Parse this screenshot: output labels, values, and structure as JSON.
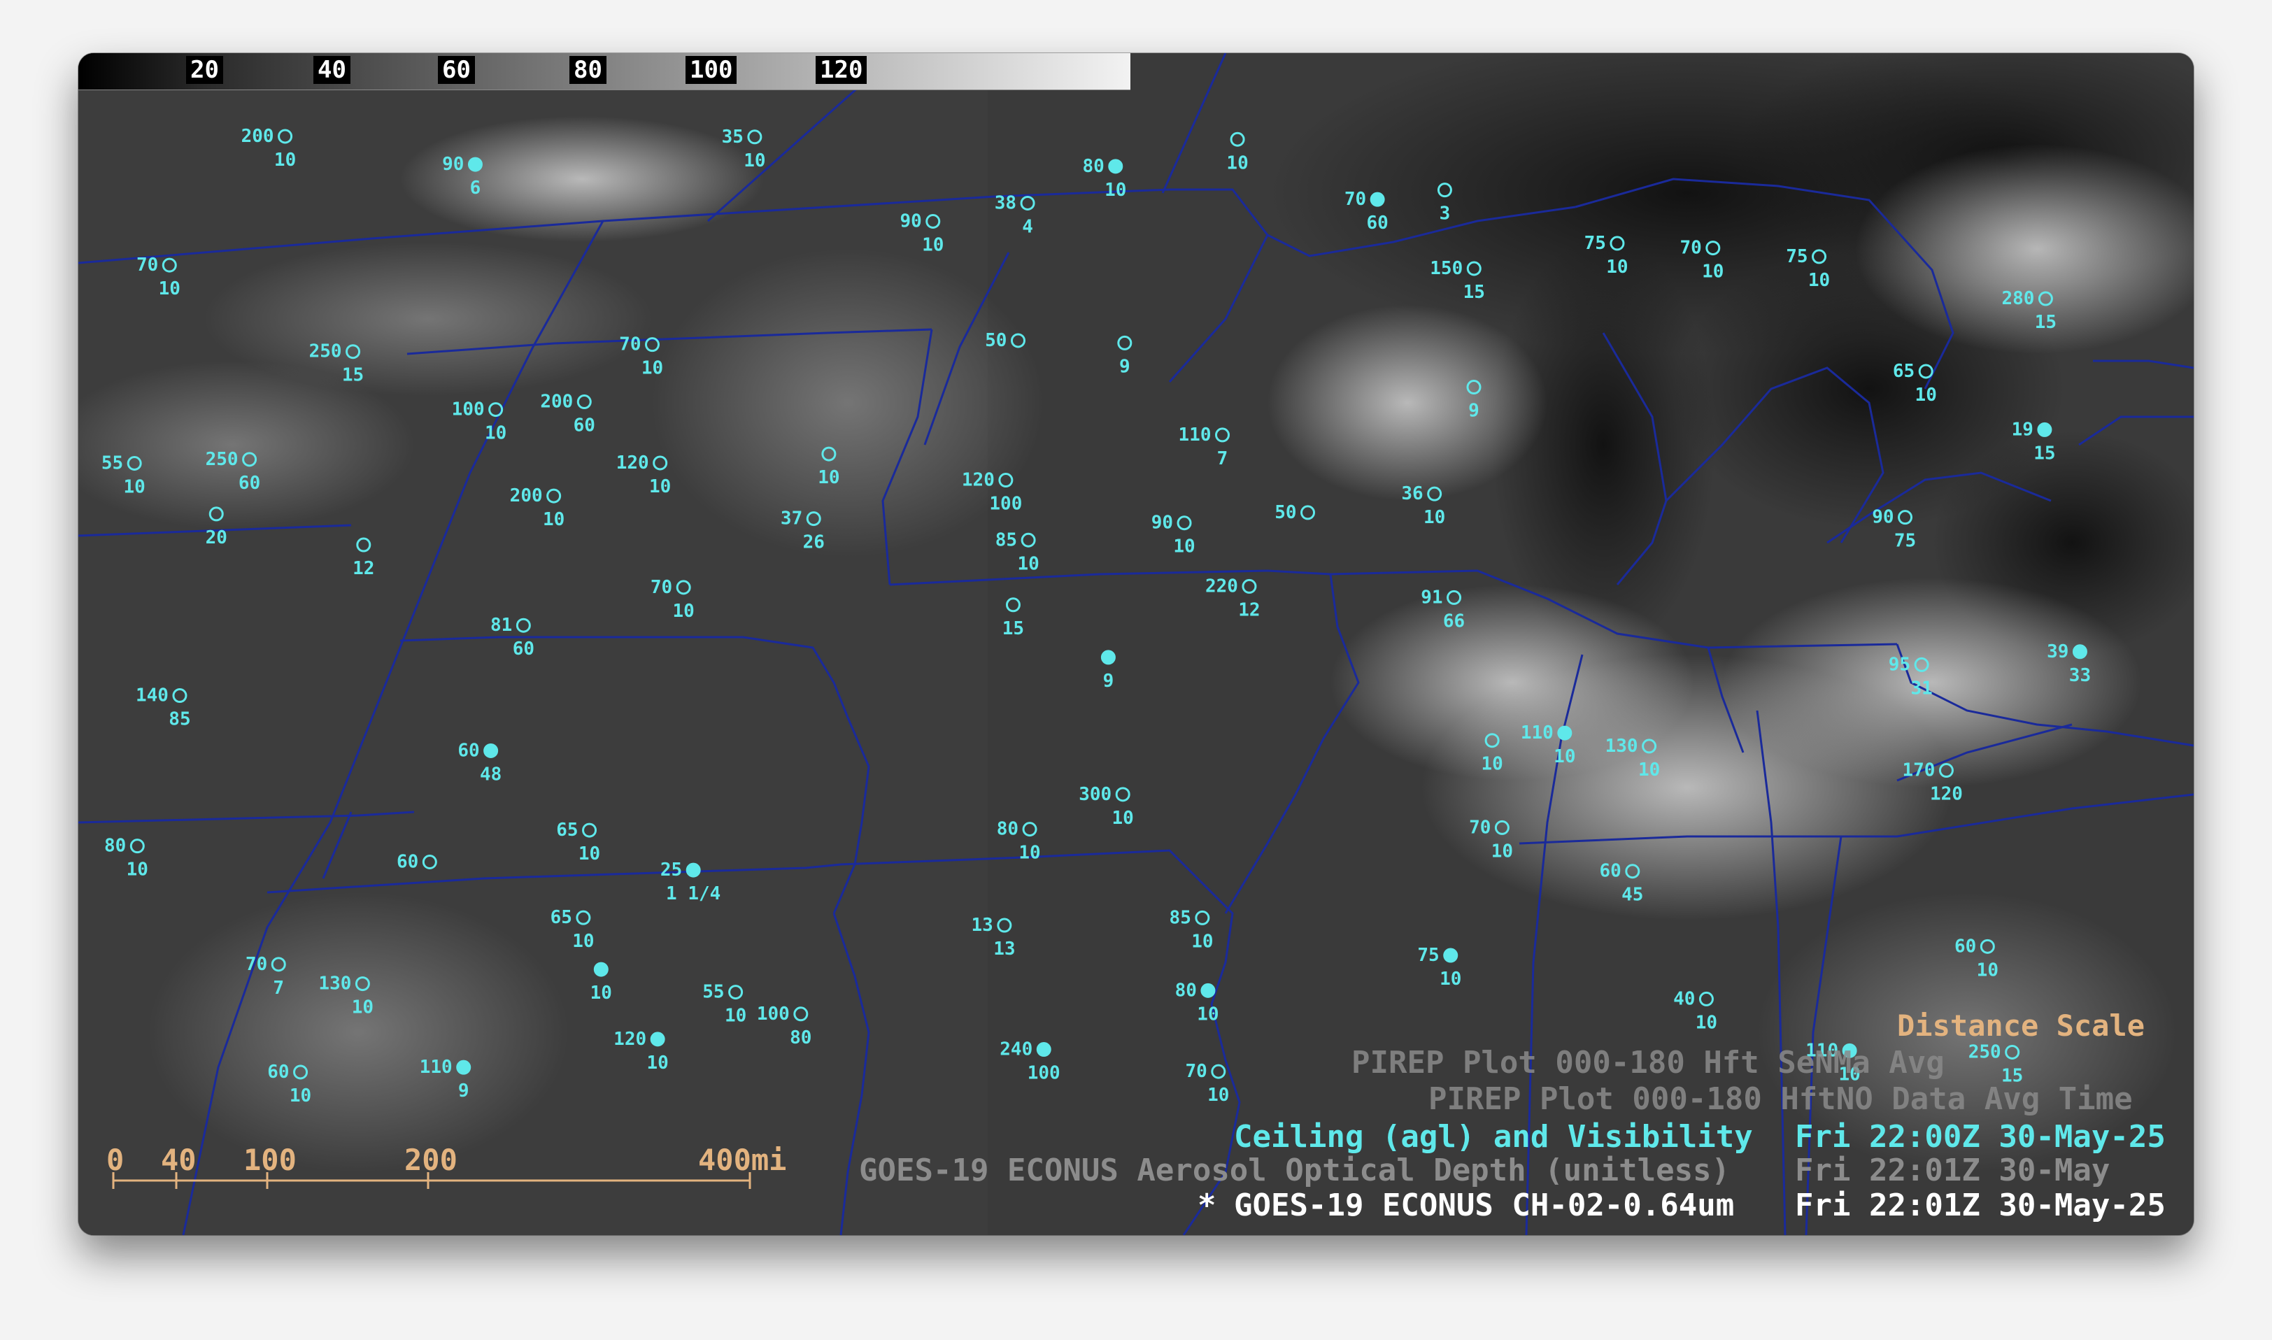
{
  "colorbar": {
    "ticks": [
      "20",
      "40",
      "60",
      "80",
      "100",
      "120"
    ]
  },
  "legend": {
    "pirep_1": "PIREP Plot 000-180 Hft SeNMa Avg",
    "pirep_2": "PIREP Plot 000-180 HftNO Data Avg Time",
    "ceiling_title": "Ceiling (agl) and Visibility",
    "ceiling_time": "Fri 22:00Z 30-May-25",
    "aerosol_title": "GOES-19 ECONUS Aerosol Optical Depth (unitless)",
    "aerosol_time": "Fri 22:01Z 30-May",
    "main_marker": "*",
    "main_title": "GOES-19 ECONUS CH-02-0.64um",
    "main_time": "Fri 22:01Z 30-May-25",
    "distance_scale": "Distance Scale"
  },
  "scale": {
    "ticks": [
      "0",
      "40",
      "100",
      "200",
      "400mi"
    ]
  },
  "colors": {
    "obs": "#5fe8ea",
    "borders": "#1a2a9a",
    "scale": "#e3b37f",
    "legend_text": "#5fe8ea",
    "legend_faded": "#8c8c8c"
  },
  "observations": [
    {
      "ceil": "",
      "vis": "9"
    },
    {
      "ceil": "250",
      "vis": "15"
    },
    {
      "ceil": "",
      "vis": "15"
    },
    {
      "ceil": "70",
      "vis": "7"
    },
    {
      "ceil": "50",
      "vis": ""
    },
    {
      "ceil": "25",
      "vis": "1 1/4"
    },
    {
      "ceil": "",
      "vis": "3"
    },
    {
      "ceil": "",
      "vis": "9"
    },
    {
      "ceil": "150",
      "vis": "15"
    },
    {
      "ceil": "220",
      "vis": "12"
    },
    {
      "ceil": "90",
      "vis": "6"
    },
    {
      "ceil": "250",
      "vis": "15"
    },
    {
      "ceil": "",
      "vis": "12"
    },
    {
      "ceil": "280",
      "vis": "15"
    },
    {
      "ceil": "",
      "vis": "9"
    },
    {
      "ceil": "110",
      "vis": "9"
    },
    {
      "ceil": "50",
      "vis": ""
    },
    {
      "ceil": "110",
      "vis": "7"
    },
    {
      "ceil": "60",
      "vis": ""
    },
    {
      "ceil": "",
      "vis": "10"
    },
    {
      "ceil": "",
      "vis": "10"
    },
    {
      "ceil": "130",
      "vis": "10"
    },
    {
      "ceil": "38",
      "vis": "4"
    },
    {
      "ceil": "",
      "vis": "20"
    },
    {
      "ceil": "",
      "vis": "10"
    },
    {
      "ceil": "19",
      "vis": "15"
    },
    {
      "ceil": "13",
      "vis": "13"
    },
    {
      "ceil": "85",
      "vis": "10"
    },
    {
      "ceil": "70",
      "vis": "10"
    },
    {
      "ceil": "75",
      "vis": "10"
    },
    {
      "ceil": "110",
      "vis": "10"
    },
    {
      "ceil": "60",
      "vis": "10"
    },
    {
      "ceil": "",
      "vis": "10"
    },
    {
      "ceil": "200",
      "vis": "10"
    },
    {
      "ceil": "70",
      "vis": "10"
    },
    {
      "ceil": "120",
      "vis": "10"
    },
    {
      "ceil": "55",
      "vis": "10"
    },
    {
      "ceil": "60",
      "vis": "10"
    },
    {
      "ceil": "65",
      "vis": "10"
    },
    {
      "ceil": "70",
      "vis": "10"
    },
    {
      "ceil": "75",
      "vis": "10"
    },
    {
      "ceil": "65",
      "vis": "10"
    },
    {
      "ceil": "200",
      "vis": "10"
    },
    {
      "ceil": "85",
      "vis": "10"
    },
    {
      "ceil": "75",
      "vis": "10"
    },
    {
      "ceil": "80",
      "vis": "10"
    },
    {
      "ceil": "70",
      "vis": "10"
    },
    {
      "ceil": "250",
      "vis": "60"
    },
    {
      "ceil": "200",
      "vis": "60"
    },
    {
      "ceil": "70",
      "vis": "10"
    },
    {
      "ceil": "70",
      "vis": "60"
    },
    {
      "ceil": "90",
      "vis": "10"
    },
    {
      "ceil": "80",
      "vis": "10"
    },
    {
      "ceil": "80",
      "vis": "10"
    },
    {
      "ceil": "100",
      "vis": "80"
    },
    {
      "ceil": "110",
      "vis": "10"
    },
    {
      "ceil": "120",
      "vis": "10"
    },
    {
      "ceil": "100",
      "vis": "10"
    },
    {
      "ceil": "140",
      "vis": "85"
    },
    {
      "ceil": "120",
      "vis": "100"
    },
    {
      "ceil": "80",
      "vis": "10"
    },
    {
      "ceil": "90",
      "vis": "10"
    },
    {
      "ceil": "130",
      "vis": "10"
    },
    {
      "ceil": "91",
      "vis": "66"
    },
    {
      "ceil": "170",
      "vis": "120"
    },
    {
      "ceil": "240",
      "vis": "100"
    },
    {
      "ceil": "90",
      "vis": "75"
    },
    {
      "ceil": "300",
      "vis": "10"
    },
    {
      "ceil": "40",
      "vis": "10"
    },
    {
      "ceil": "70",
      "vis": "10"
    },
    {
      "ceil": "39",
      "vis": "33"
    },
    {
      "ceil": "36",
      "vis": "10"
    },
    {
      "ceil": "60",
      "vis": "45"
    },
    {
      "ceil": "81",
      "vis": "60"
    },
    {
      "ceil": "35",
      "vis": "10"
    },
    {
      "ceil": "60",
      "vis": "48"
    },
    {
      "ceil": "65",
      "vis": "10"
    },
    {
      "ceil": "55",
      "vis": "10"
    },
    {
      "ceil": "37",
      "vis": "26"
    },
    {
      "ceil": "95",
      "vis": "31"
    }
  ]
}
